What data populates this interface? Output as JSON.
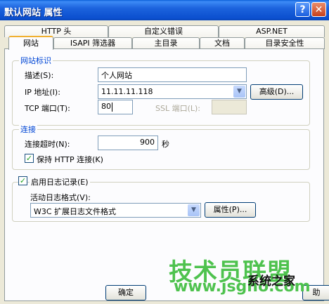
{
  "window": {
    "title": "默认网站 属性",
    "help_label": "?",
    "close_label": "✕"
  },
  "tabs": {
    "row1": [
      "HTTP 头",
      "自定义错误",
      "ASP.NET"
    ],
    "row2": [
      "网站",
      "ISAPI 筛选器",
      "主目录",
      "文档",
      "目录安全性"
    ],
    "active": "网站"
  },
  "site_id": {
    "legend": "网站标识",
    "desc_label": "描述(S):",
    "desc_value": "个人网站",
    "ip_label": "IP 地址(I):",
    "ip_value": "11.11.11.118",
    "advanced_label": "高级(D)...",
    "tcp_label": "TCP 端口(T):",
    "tcp_value": "80",
    "ssl_label": "SSL 端口(L):",
    "ssl_value": ""
  },
  "connection": {
    "legend": "连接",
    "timeout_label": "连接超时(N):",
    "timeout_value": "900",
    "timeout_unit": "秒",
    "keepalive_label": "保持 HTTP 连接(K)",
    "keepalive_checked": true
  },
  "logging": {
    "enable_label": "启用日志记录(E)",
    "enable_checked": true,
    "format_label": "活动日志格式(V):",
    "format_value": "W3C 扩展日志文件格式",
    "properties_label": "属性(P)..."
  },
  "footer": {
    "ok_label": "确定",
    "cancel_partial": "助"
  },
  "watermark": {
    "big": "技术员联盟",
    "url": "www.jsgho.com",
    "brand": "系统之家"
  }
}
